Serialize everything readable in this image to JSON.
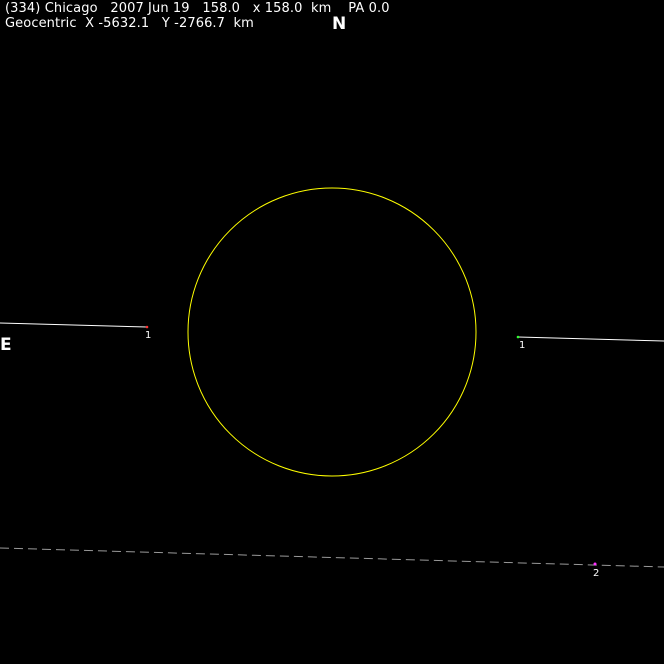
{
  "header": {
    "line1": "(334) Chicago   2007 Jun 19   158.0   x 158.0  km    PA 0.0",
    "line2": "Geocentric  X -5632.1   Y -2766.7  km"
  },
  "compass": {
    "north": "N",
    "east": "E"
  },
  "colors": {
    "background": "#000000",
    "text": "#ffffff",
    "asteroid_outline": "#ffff00",
    "chord": "#ffffff",
    "chord_negative": "#888888",
    "disappear_marker": "#ff3333",
    "reappear_marker": "#33ff33",
    "miss_marker": "#ff33ff"
  },
  "markers": {
    "chord1_disappear": "1",
    "chord1_reappear": "1",
    "chord2": "2"
  }
}
